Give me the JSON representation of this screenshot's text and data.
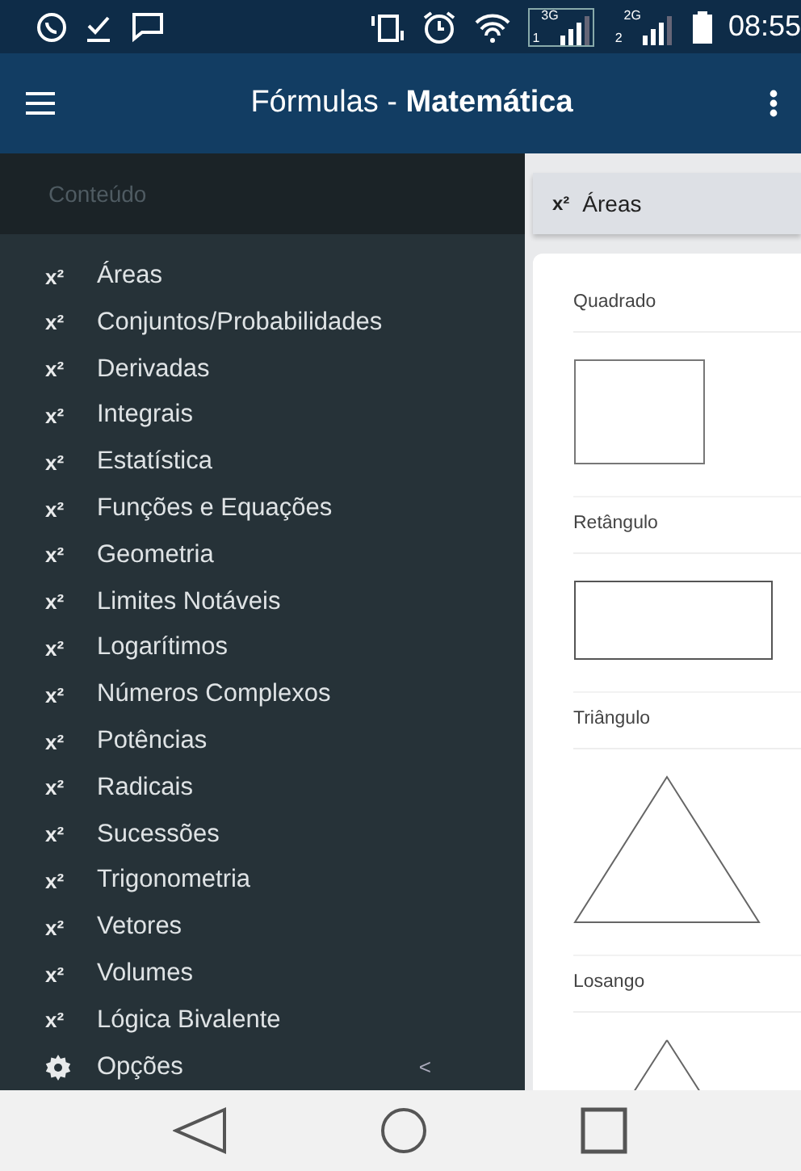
{
  "status_bar": {
    "signals": [
      {
        "network": "3G",
        "sim": "1",
        "selected": true
      },
      {
        "network": "2G",
        "sim": "2",
        "selected": false
      }
    ],
    "time": "08:55"
  },
  "app_bar": {
    "title": "Fórmulas - **Matemática**"
  },
  "drawer": {
    "header": "Conteúdo",
    "items": [
      {
        "kind": "formula",
        "prefix": "x²",
        "label": "Áreas"
      },
      {
        "kind": "formula",
        "prefix": "x²",
        "label": "Conjuntos/Probabilidades"
      },
      {
        "kind": "formula",
        "prefix": "x²",
        "label": "Derivadas"
      },
      {
        "kind": "formula",
        "prefix": "x²",
        "label": "Integrais"
      },
      {
        "kind": "formula",
        "prefix": "x²",
        "label": "Estatística"
      },
      {
        "kind": "formula",
        "prefix": "x²",
        "label": "Funções e Equações"
      },
      {
        "kind": "formula",
        "prefix": "x²",
        "label": "Geometria"
      },
      {
        "kind": "formula",
        "prefix": "x²",
        "label": "Limites Notáveis"
      },
      {
        "kind": "formula",
        "prefix": "x²",
        "label": "Logarítimos"
      },
      {
        "kind": "formula",
        "prefix": "x²",
        "label": "Números Complexos"
      },
      {
        "kind": "formula",
        "prefix": "x²",
        "label": "Potências"
      },
      {
        "kind": "formula",
        "prefix": "x²",
        "label": "Radicais"
      },
      {
        "kind": "formula",
        "prefix": "x²",
        "label": "Sucessões"
      },
      {
        "kind": "formula",
        "prefix": "x²",
        "label": "Trigonometria"
      },
      {
        "kind": "formula",
        "prefix": "x²",
        "label": "Vetores"
      },
      {
        "kind": "formula",
        "prefix": "x²",
        "label": "Volumes"
      },
      {
        "kind": "formula",
        "prefix": "x²",
        "label": "Lógica Bivalente"
      },
      {
        "kind": "settings",
        "label": "Opções",
        "chevron": "<"
      }
    ]
  },
  "content": {
    "tab": {
      "prefix": "x²",
      "label": "Áreas"
    },
    "shapes": [
      {
        "kind": "square",
        "label": "Quadrado"
      },
      {
        "kind": "rectangle",
        "label": "Retângulo"
      },
      {
        "kind": "triangle",
        "label": "Triângulo"
      },
      {
        "kind": "rhombus",
        "label": "Losango"
      }
    ]
  }
}
